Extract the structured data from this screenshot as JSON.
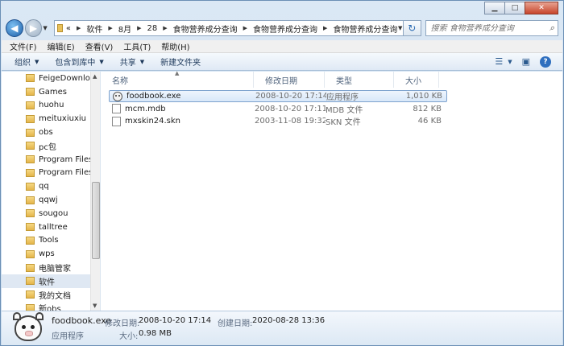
{
  "window": {
    "minimize_glyph": "▁",
    "maximize_glyph": "□",
    "close_glyph": "✕"
  },
  "address_bar": {
    "overflow": "«",
    "parts": [
      "软件",
      "8月",
      "28",
      "食物营养成分查询",
      "食物营养成分查询",
      "食物营养成分查询"
    ]
  },
  "search": {
    "placeholder": "搜索 食物营养成分查询"
  },
  "menu": [
    "文件(F)",
    "编辑(E)",
    "查看(V)",
    "工具(T)",
    "帮助(H)"
  ],
  "toolbar": {
    "organize": "组织",
    "include_in_library": "包含到库中",
    "share": "共享",
    "new_folder": "新建文件夹",
    "help": "?"
  },
  "sidebar": {
    "items": [
      {
        "label": "FeigeDownloa",
        "selected": false
      },
      {
        "label": "Games",
        "selected": false
      },
      {
        "label": "huohu",
        "selected": false
      },
      {
        "label": "meituxiuxiu",
        "selected": false
      },
      {
        "label": "obs",
        "selected": false
      },
      {
        "label": "pc包",
        "selected": false
      },
      {
        "label": "Program Files",
        "selected": false
      },
      {
        "label": "Program Files",
        "selected": false
      },
      {
        "label": "qq",
        "selected": false
      },
      {
        "label": "qqwj",
        "selected": false
      },
      {
        "label": "sougou",
        "selected": false
      },
      {
        "label": "talltree",
        "selected": false
      },
      {
        "label": "Tools",
        "selected": false
      },
      {
        "label": "wps",
        "selected": false
      },
      {
        "label": "电脑管家",
        "selected": false
      },
      {
        "label": "软件",
        "selected": true
      },
      {
        "label": "我的文档",
        "selected": false
      },
      {
        "label": "新obs",
        "selected": false
      }
    ]
  },
  "columns": {
    "name": "名称",
    "date": "修改日期",
    "type": "类型",
    "size": "大小"
  },
  "files": [
    {
      "name": "foodbook.exe",
      "date": "2008-10-20 17:14",
      "type": "应用程序",
      "size": "1,010 KB",
      "icon": "exe",
      "selected": true
    },
    {
      "name": "mcm.mdb",
      "date": "2008-10-20 17:11",
      "type": "MDB 文件",
      "size": "812 KB",
      "icon": "file",
      "selected": false
    },
    {
      "name": "mxskin24.skn",
      "date": "2003-11-08 19:32",
      "type": "SKN 文件",
      "size": "46 KB",
      "icon": "file",
      "selected": false
    }
  ],
  "details": {
    "name": "foodbook.exe",
    "modified_label": "修改日期:",
    "modified_value": "2008-10-20 17:14",
    "created_label": "创建日期:",
    "created_value": "2020-08-28 13:36",
    "type": "应用程序",
    "size_label": "大小:",
    "size_value": "0.98 MB"
  }
}
